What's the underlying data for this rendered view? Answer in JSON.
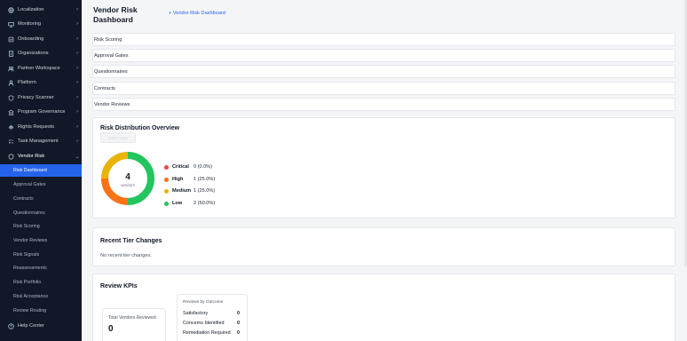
{
  "sidebar": {
    "items": [
      {
        "label": "Localization",
        "icon": "globe-icon"
      },
      {
        "label": "Monitoring",
        "icon": "monitor-icon"
      },
      {
        "label": "Onboarding",
        "icon": "onboarding-icon"
      },
      {
        "label": "Organizations",
        "icon": "building-icon"
      },
      {
        "label": "Partner Workspace",
        "icon": "users-icon"
      },
      {
        "label": "Platform",
        "icon": "user-icon"
      },
      {
        "label": "Privacy Scanner",
        "icon": "scan-icon"
      },
      {
        "label": "Program Governance",
        "icon": "governance-icon"
      },
      {
        "label": "Rights Requests",
        "icon": "rights-icon"
      },
      {
        "label": "Task Management",
        "icon": "tasks-icon"
      },
      {
        "label": "Vendor Risk",
        "icon": "shield-icon"
      }
    ],
    "vendor_risk_subitems": [
      {
        "label": "Risk Dashboard"
      },
      {
        "label": "Approval Gates"
      },
      {
        "label": "Contracts"
      },
      {
        "label": "Questionnaires"
      },
      {
        "label": "Risk Scoring"
      },
      {
        "label": "Vendor Reviews"
      },
      {
        "label": "Risk Signals"
      },
      {
        "label": "Reassessments"
      },
      {
        "label": "Risk Portfolio"
      },
      {
        "label": "Risk Acceptance"
      },
      {
        "label": "Review Routing"
      }
    ],
    "help": {
      "label": "Help Center",
      "icon": "help-icon"
    }
  },
  "header": {
    "title": "Vendor Risk Dashboard",
    "add_link": "+ Vendor Risk Dashboard"
  },
  "sections": [
    {
      "label": "Risk Scoring"
    },
    {
      "label": "Approval Gates"
    },
    {
      "label": "Questionnaires"
    },
    {
      "label": "Contracts"
    },
    {
      "label": "Vendor Reviews"
    }
  ],
  "risk_distribution": {
    "title": "Risk Distribution Overview",
    "filter_label": "Select view",
    "total": "4",
    "total_label": "vendors",
    "tiers": [
      {
        "name": "Critical",
        "value": "0 (0.0%)",
        "count": 0,
        "color": "#ef4444"
      },
      {
        "name": "High",
        "value": "1 (25.0%)",
        "count": 1,
        "color": "#f97316"
      },
      {
        "name": "Medium",
        "value": "1 (25.0%)",
        "count": 1,
        "color": "#eab308"
      },
      {
        "name": "Low",
        "value": "2 (50.0%)",
        "count": 2,
        "color": "#22c55e"
      }
    ]
  },
  "recent_changes": {
    "title": "Recent Tier Changes",
    "empty": "No recent tier changes."
  },
  "kpis": {
    "title": "Review KPIs",
    "total_reviewed_label": "Total Vendors Reviewed",
    "total_reviewed_value": "0",
    "outcome_title": "Reviews by Outcome",
    "outcomes": [
      {
        "label": "Satisfactory",
        "value": "0"
      },
      {
        "label": "Concerns Identified",
        "value": "0"
      },
      {
        "label": "Remediation Required",
        "value": "0"
      }
    ]
  },
  "colors": {
    "sidebar_bg": "#111827",
    "accent": "#2563eb",
    "critical": "#ef4444",
    "high": "#f97316",
    "medium": "#eab308",
    "low": "#22c55e"
  }
}
